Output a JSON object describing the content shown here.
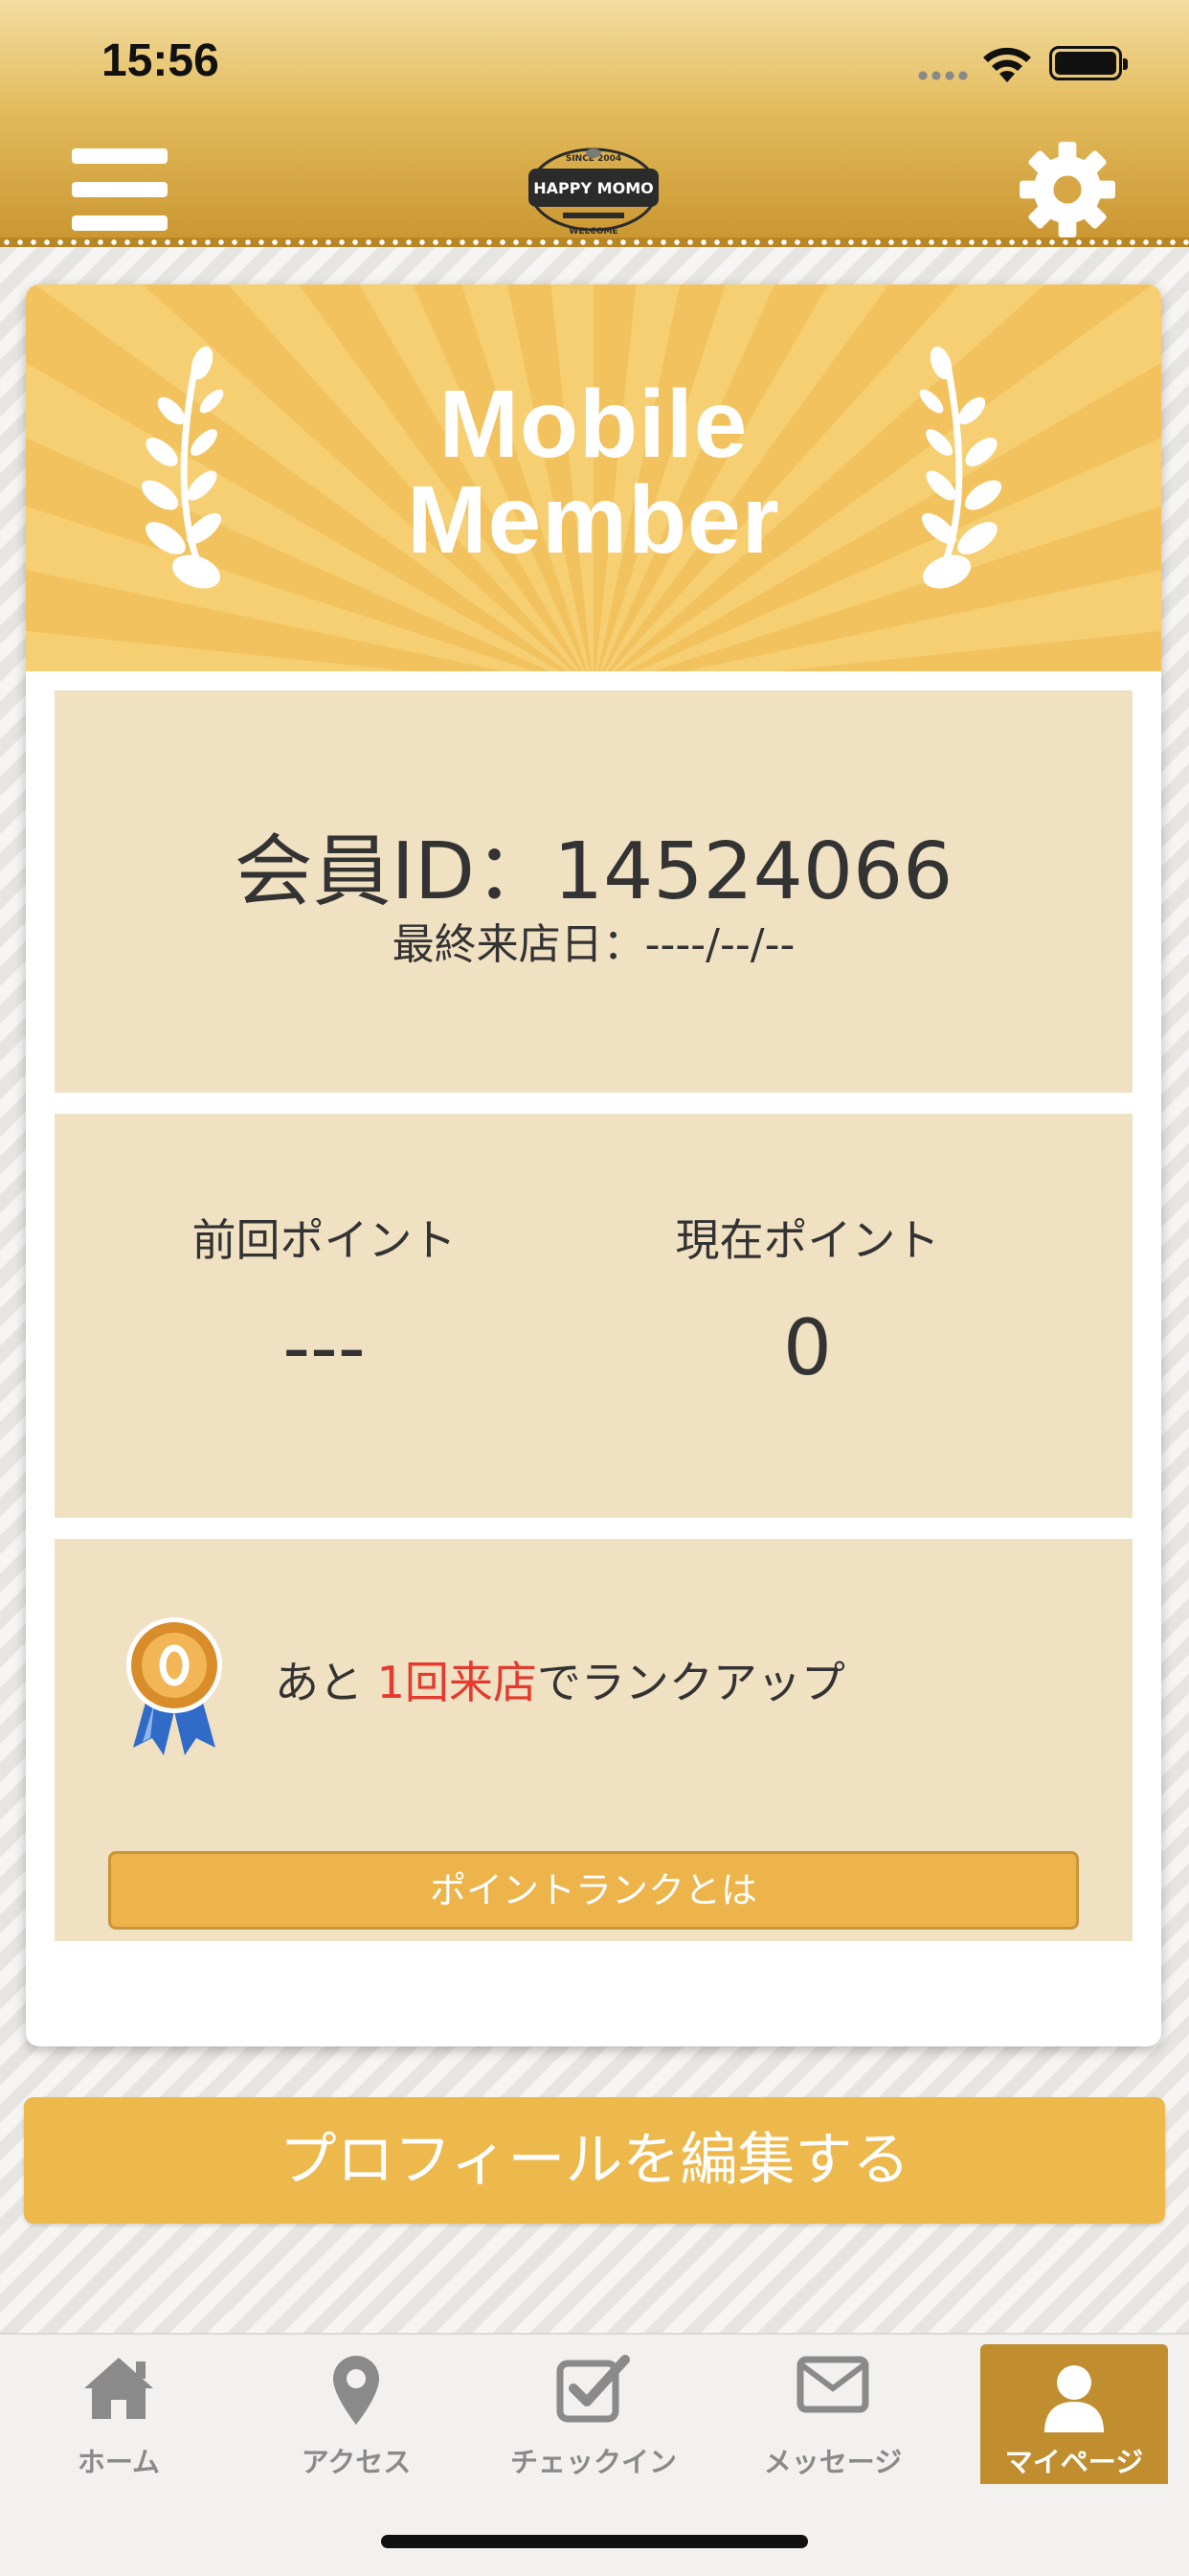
{
  "status_bar": {
    "time": "15:56"
  },
  "header": {
    "logo": {
      "since": "SINCE 2004",
      "name": "HAPPY MOMO",
      "welcome": "WELCOME"
    }
  },
  "card": {
    "banner": {
      "line1": "Mobile",
      "line2": "Member"
    },
    "member_id": "会員ID：14524066",
    "last_visit": "最終来店日：----/--/--",
    "points": {
      "previous_label": "前回ポイント",
      "previous_value": "---",
      "current_label": "現在ポイント",
      "current_value": "0"
    },
    "rank": {
      "text_before": "あと ",
      "text_accent": "1回来店",
      "text_after": "でランクアップ",
      "accent_color": "#e53a2d",
      "button_label": "ポイントランクとは",
      "medal_icon": "bronze-medal-icon"
    }
  },
  "profile_button_label": "プロフィールを編集する",
  "tabbar": {
    "active_color": "#c08e2e",
    "tabs": [
      {
        "label": "ホーム",
        "icon": "home-icon"
      },
      {
        "label": "アクセス",
        "icon": "map-pin-icon"
      },
      {
        "label": "チェックイン",
        "icon": "checkin-icon"
      },
      {
        "label": "メッセージ",
        "icon": "mail-icon"
      },
      {
        "label": "マイページ",
        "icon": "user-icon",
        "active": true
      }
    ]
  }
}
